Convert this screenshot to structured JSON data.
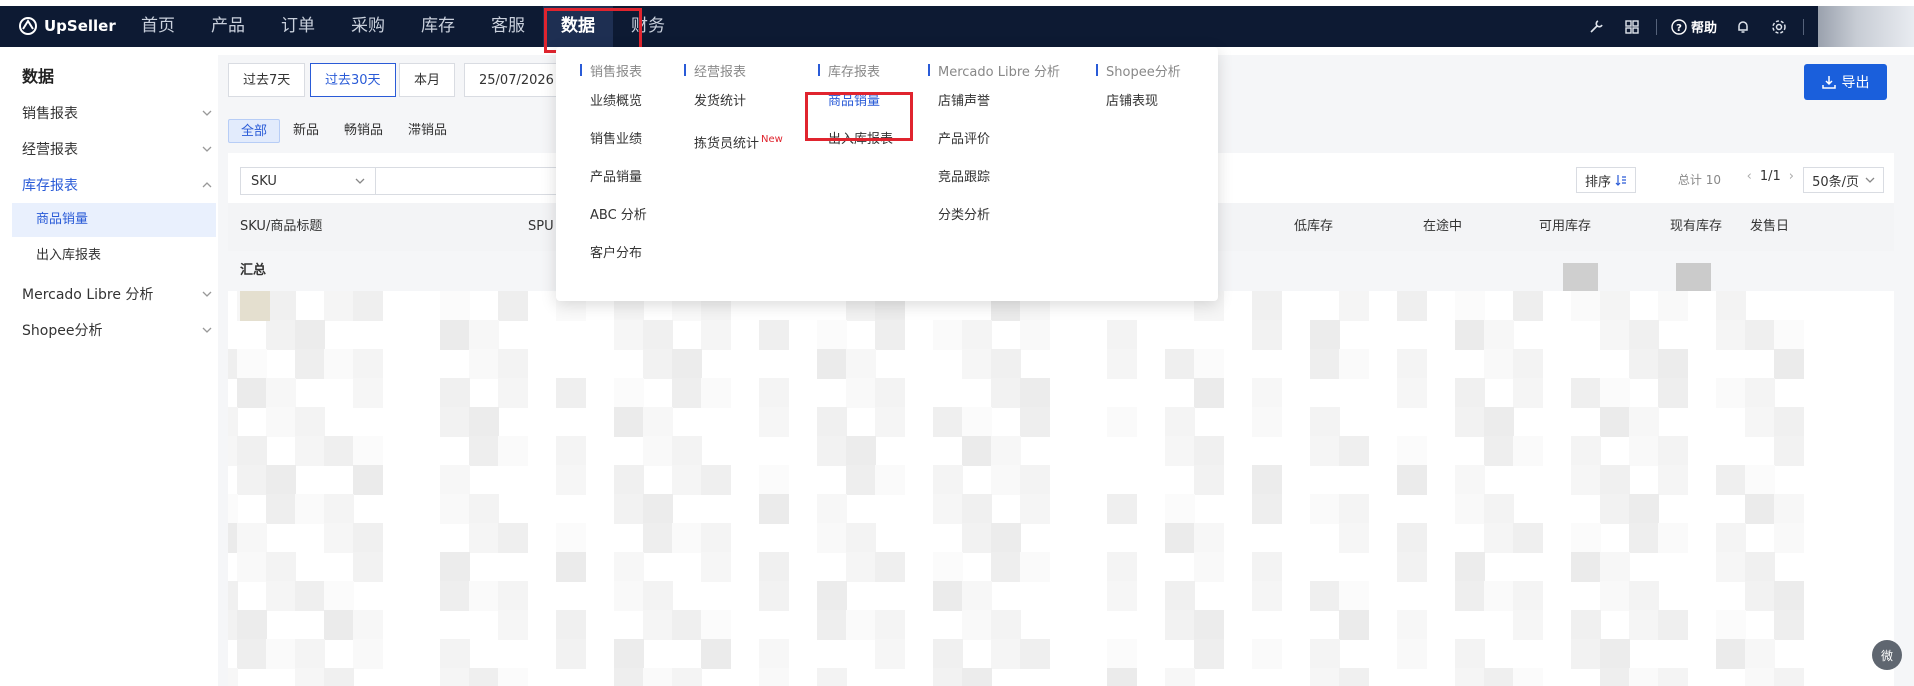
{
  "app": {
    "logo_text": "UpSeller"
  },
  "nav": {
    "items": [
      {
        "label": "首页"
      },
      {
        "label": "产品"
      },
      {
        "label": "订单"
      },
      {
        "label": "采购"
      },
      {
        "label": "库存"
      },
      {
        "label": "客服"
      },
      {
        "label": "数据"
      },
      {
        "label": "财务"
      }
    ],
    "active": "数据",
    "help_label": "帮助"
  },
  "sidebar": {
    "title": "数据",
    "groups": [
      {
        "label": "销售报表"
      },
      {
        "label": "经营报表"
      },
      {
        "label": "库存报表"
      },
      {
        "label": "Mercado Libre 分析"
      },
      {
        "label": "Shopee分析"
      }
    ],
    "sub_items": [
      {
        "label": "商品销量"
      },
      {
        "label": "出入库报表"
      }
    ]
  },
  "date_range": {
    "buttons": [
      {
        "label": "过去7天"
      },
      {
        "label": "过去30天"
      },
      {
        "label": "本月"
      }
    ],
    "start_date": "25/07/2026"
  },
  "filter_tabs": [
    {
      "label": "全部"
    },
    {
      "label": "新品"
    },
    {
      "label": "畅销品"
    },
    {
      "label": "滞销品"
    }
  ],
  "export_label": "导出",
  "search": {
    "field": "SKU"
  },
  "toolbar": {
    "sort_label": "排序",
    "total": "总计 10",
    "page": "1/1",
    "page_size": "50条/页"
  },
  "table": {
    "columns": [
      "SKU/商品标题",
      "SPU",
      "低库存",
      "在途中",
      "可用库存",
      "现有库存",
      "发售日"
    ],
    "summary_label": "汇总"
  },
  "dropdown": {
    "columns": [
      {
        "header": "销售报表",
        "items": [
          "业绩概览",
          "销售业绩",
          "产品销量",
          "ABC 分析",
          "客户分布"
        ]
      },
      {
        "header": "经营报表",
        "items": [
          "发货统计",
          "拣货员统计"
        ],
        "new_badge": "New"
      },
      {
        "header": "库存报表",
        "items": [
          "商品销量",
          "出入库报表"
        ]
      },
      {
        "header": "Mercado Libre 分析",
        "items": [
          "店铺声誉",
          "产品评价",
          "竞品跟踪",
          "分类分析"
        ]
      },
      {
        "header": "Shopee分析",
        "items": [
          "店铺表现"
        ]
      }
    ]
  },
  "float_button_label": "微"
}
